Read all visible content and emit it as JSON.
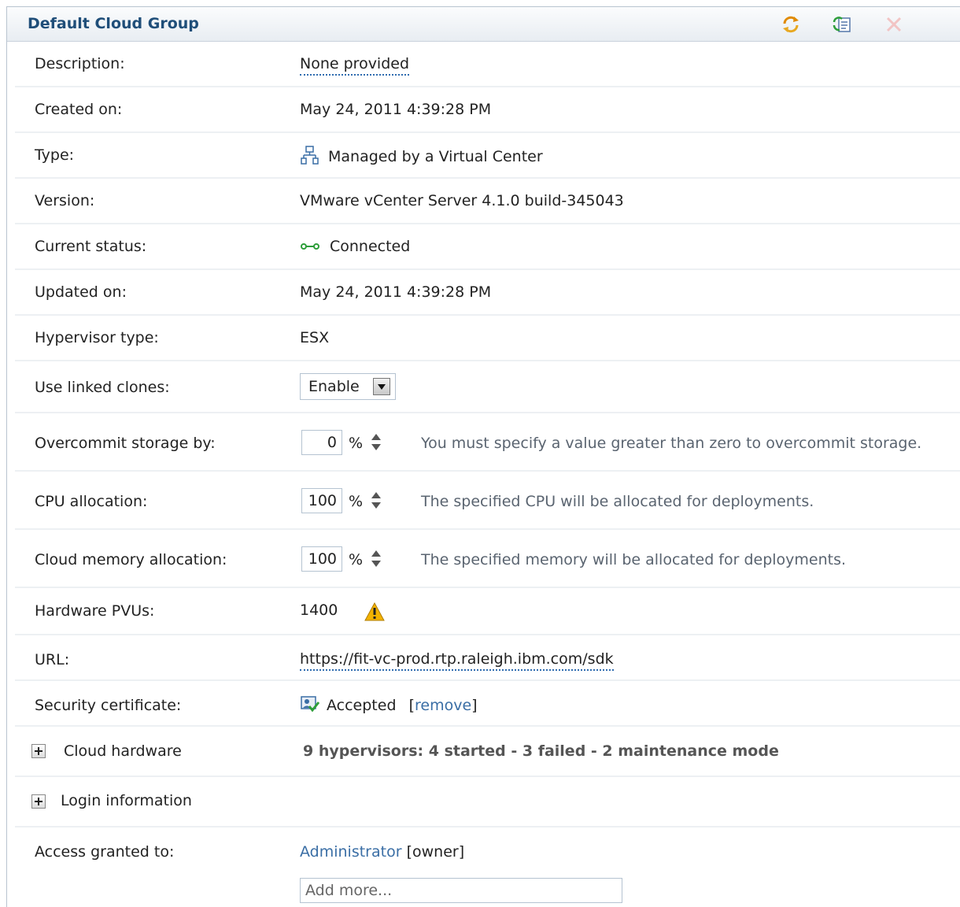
{
  "panel": {
    "title": "Default Cloud Group",
    "toolbar_icons": [
      "refresh-icon",
      "edit-icon",
      "delete-icon"
    ]
  },
  "fields": {
    "description": {
      "label": "Description:",
      "value": "None provided"
    },
    "created_on": {
      "label": "Created on:",
      "value": "May 24, 2011 4:39:28 PM"
    },
    "type": {
      "label": "Type:",
      "value": "Managed by a Virtual Center",
      "icon": "virtual-center-icon"
    },
    "version": {
      "label": "Version:",
      "value": "VMware vCenter Server 4.1.0 build-345043"
    },
    "current_status": {
      "label": "Current status:",
      "value": "Connected",
      "icon": "connected-icon"
    },
    "updated_on": {
      "label": "Updated on:",
      "value": "May 24, 2011 4:39:28 PM"
    },
    "hypervisor_type": {
      "label": "Hypervisor type:",
      "value": "ESX"
    },
    "linked_clones": {
      "label": "Use linked clones:",
      "selected": "Enable"
    },
    "overcommit_storage": {
      "label": "Overcommit storage by:",
      "value": "0",
      "unit": "%",
      "hint": "You must specify a value greater than zero to overcommit storage."
    },
    "cpu_allocation": {
      "label": "CPU allocation:",
      "value": "100",
      "unit": "%",
      "hint": "The specified CPU will be allocated for deployments."
    },
    "memory_allocation": {
      "label": "Cloud memory allocation:",
      "value": "100",
      "unit": "%",
      "hint": "The specified memory will be allocated for deployments."
    },
    "hardware_pvus": {
      "label": "Hardware PVUs:",
      "value": "1400",
      "icon": "warning-icon"
    },
    "url": {
      "label": "URL:",
      "value": "https://fit-vc-prod.rtp.raleigh.ibm.com/sdk"
    },
    "security_certificate": {
      "label": "Security certificate:",
      "value": "Accepted",
      "action": "[remove]",
      "action_prefix": "[",
      "action_link": "remove",
      "action_suffix": "]",
      "icon": "certificate-icon"
    },
    "cloud_hardware": {
      "label": "Cloud hardware",
      "summary": "9 hypervisors: 4 started - 3 failed - 2 maintenance mode"
    },
    "login_information": {
      "label": "Login information"
    },
    "access": {
      "label": "Access granted to:",
      "user": "Administrator",
      "role": "[owner]",
      "add_placeholder": "Add more..."
    }
  },
  "colors": {
    "title": "#1f4e79",
    "link": "#3a6ea5",
    "hint": "#5a6470",
    "warning": "#f3b200"
  }
}
